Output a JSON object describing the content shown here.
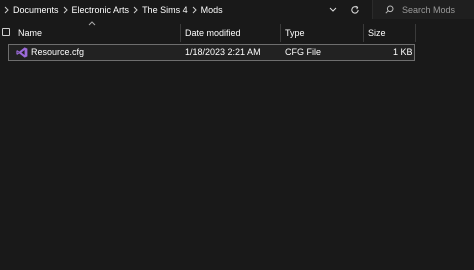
{
  "breadcrumb": {
    "items": [
      "Documents",
      "Electronic Arts",
      "The Sims 4",
      "Mods"
    ]
  },
  "search": {
    "placeholder": "Search Mods"
  },
  "columns": {
    "name": "Name",
    "date_modified": "Date modified",
    "type": "Type",
    "size": "Size"
  },
  "files": [
    {
      "name": "Resource.cfg",
      "date_modified": "1/18/2023 2:21 AM",
      "type": "CFG File",
      "size": "1 KB",
      "icon": "visual-studio-icon"
    }
  ],
  "colors": {
    "background": "#191919",
    "icon_purple": "#9b6ad9",
    "row_border": "#6e6e6e"
  }
}
